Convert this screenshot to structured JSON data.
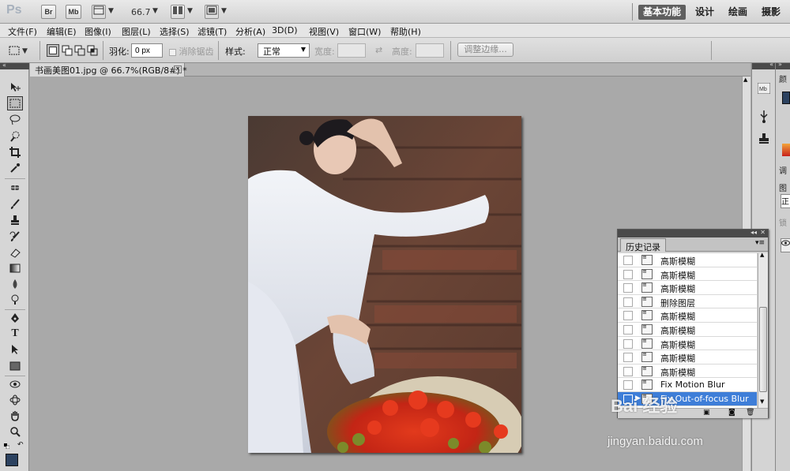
{
  "app": {
    "logo": "Ps",
    "bridge_button": "Br",
    "minibridge_button": "Mb",
    "zoom_value": "66.7",
    "workspaces": [
      {
        "label": "基本功能",
        "active": true
      },
      {
        "label": "设计",
        "active": false
      },
      {
        "label": "绘画",
        "active": false
      },
      {
        "label": "摄影",
        "active": false
      }
    ]
  },
  "menu": [
    "文件(F)",
    "编辑(E)",
    "图像(I)",
    "图层(L)",
    "选择(S)",
    "滤镜(T)",
    "分析(A)",
    "3D(D)",
    "视图(V)",
    "窗口(W)",
    "帮助(H)"
  ],
  "options": {
    "feather_label": "羽化:",
    "feather_value": "0 px",
    "antialias_label": "消除锯齿",
    "style_label": "样式:",
    "style_value": "正常",
    "width_label": "宽度:",
    "height_label": "高度:",
    "refine_edge_button": "调整边缘..."
  },
  "document": {
    "tab_title": "书画美图01.jpg @ 66.7%(RGB/8#) *"
  },
  "colors": {
    "foreground": "#2c4260",
    "background": "#ffffff",
    "selection": "#3e7ed8",
    "active_workspace": "#5f5f5f"
  },
  "right_dock": {
    "labels": [
      "颜",
      "调",
      "图",
      "正",
      "锁"
    ]
  },
  "history": {
    "panel_title": "历史记录",
    "items": [
      {
        "label": "高斯模糊",
        "selected": false
      },
      {
        "label": "高斯模糊",
        "selected": false
      },
      {
        "label": "高斯模糊",
        "selected": false
      },
      {
        "label": "删除图层",
        "selected": false
      },
      {
        "label": "高斯模糊",
        "selected": false
      },
      {
        "label": "高斯模糊",
        "selected": false
      },
      {
        "label": "高斯模糊",
        "selected": false
      },
      {
        "label": "高斯模糊",
        "selected": false
      },
      {
        "label": "高斯模糊",
        "selected": false
      },
      {
        "label": "Fix Motion Blur",
        "selected": false
      },
      {
        "label": "Fix Out-of-focus Blur",
        "selected": true
      }
    ]
  },
  "watermark": {
    "brand": "Bai 经验",
    "url": "jingyan.baidu.com"
  }
}
